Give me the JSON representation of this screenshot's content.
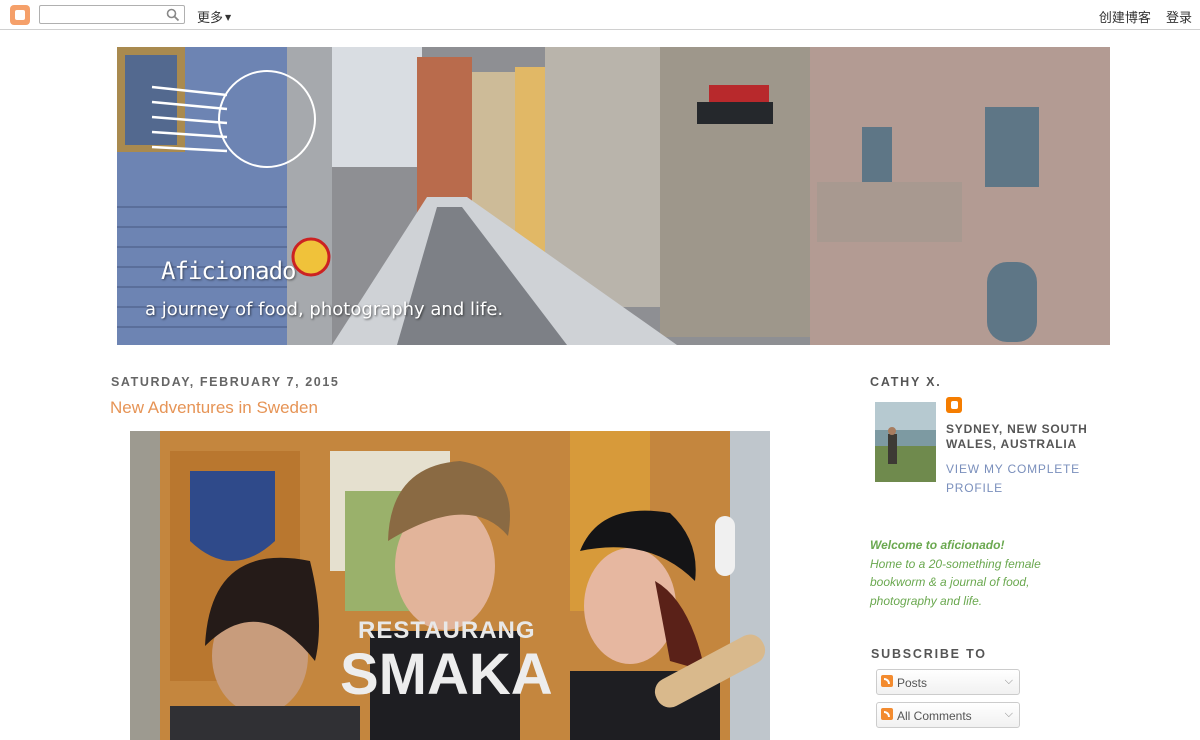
{
  "navbar": {
    "logo_icon": "blogger-logo-icon",
    "search_placeholder": "",
    "more_label": "更多",
    "create_blog_label": "创建博客",
    "login_label": "登录"
  },
  "header": {
    "title": "Aficionado",
    "description": "a journey of food, photography and life."
  },
  "post": {
    "date": "SATURDAY, FEBRUARY 7, 2015",
    "title": "New Adventures in Sweden",
    "image_text_line1": "RESTAURANG",
    "image_text_line2": "SMAKA"
  },
  "sidebar": {
    "profile_heading": "CATHY X.",
    "location": "SYDNEY, NEW SOUTH WALES, AUSTRALIA",
    "profile_link": "VIEW MY COMPLETE PROFILE",
    "welcome_title": "Welcome to aficionado!",
    "welcome_text": "Home to a 20-something female bookworm & a journal of food, photography and life.",
    "subscribe_heading": "SUBSCRIBE TO",
    "subscribe_options": [
      {
        "label": "Posts"
      },
      {
        "label": "All Comments"
      }
    ]
  },
  "colors": {
    "post_title": "#e69456",
    "profile_link": "#7a8fbc",
    "welcome_text": "#6aa84f",
    "blogger_orange": "#f57d00"
  }
}
